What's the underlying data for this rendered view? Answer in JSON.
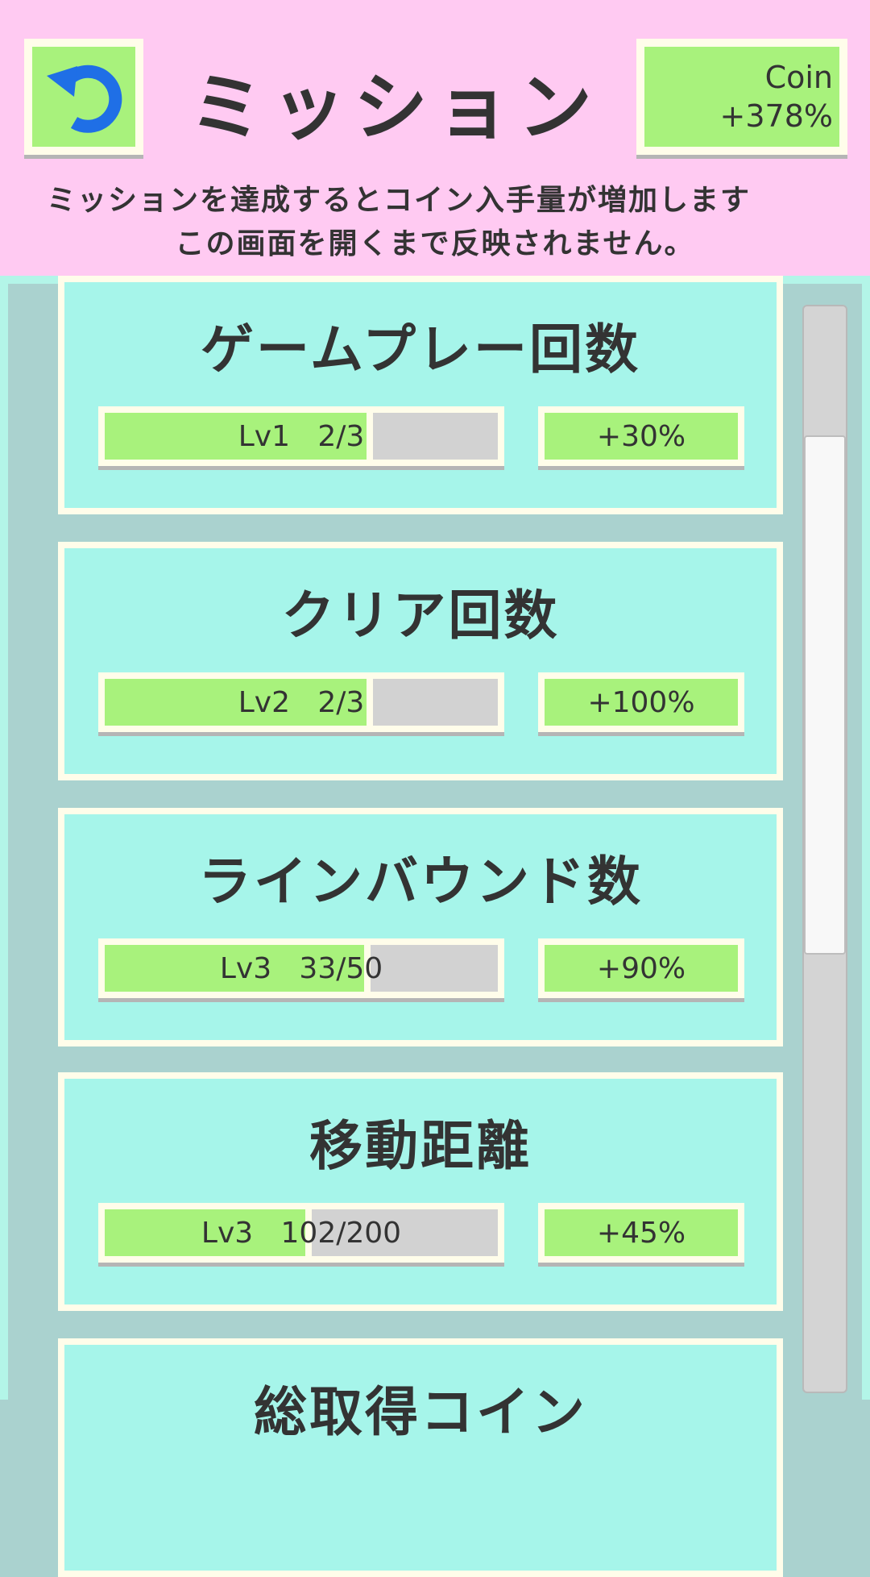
{
  "header": {
    "title": "ミッション",
    "coin_label": "Coin",
    "coin_bonus": "+378%",
    "description_line1": "ミッションを達成するとコイン入手量が増加します",
    "description_line2": "この画面を開くまで反映されません。",
    "back_icon": "undo-arrow-icon"
  },
  "missions": [
    {
      "title": "ゲームプレー回数",
      "progress_label": "Lv1   2/3",
      "progress": 0.667,
      "bonus": "+30%"
    },
    {
      "title": "クリア回数",
      "progress_label": "Lv2   2/3",
      "progress": 0.667,
      "bonus": "+100%"
    },
    {
      "title": "ラインバウンド数",
      "progress_label": "Lv3   33/50",
      "progress": 0.66,
      "bonus": "+90%"
    },
    {
      "title": "移動距離",
      "progress_label": "Lv3   102/200",
      "progress": 0.51,
      "bonus": "+45%"
    },
    {
      "title": "総取得コイン",
      "progress_label": "",
      "progress": 0,
      "bonus": ""
    }
  ],
  "colors": {
    "header_bg": "#ffcaf2",
    "card_face": "#a6f5ea",
    "accent_green": "#a8f27c",
    "icon_blue": "#1f6fe6"
  }
}
